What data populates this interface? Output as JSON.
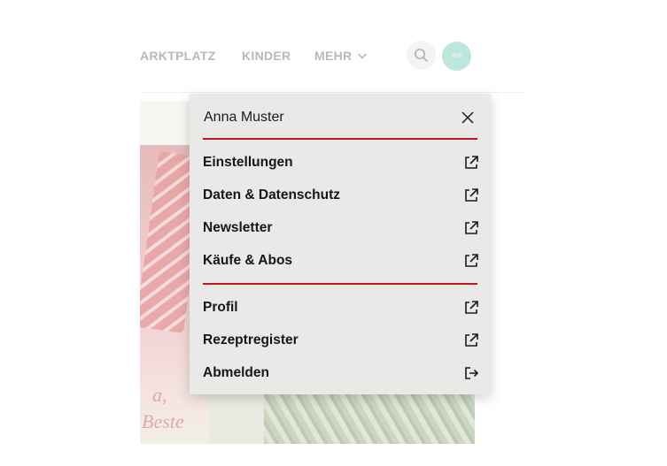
{
  "nav": {
    "items": [
      {
        "label": "MARKTPLATZ"
      },
      {
        "label": "KINDER"
      },
      {
        "label": "MEHR"
      }
    ]
  },
  "avatar": {
    "initials": "AM"
  },
  "hero": {
    "text_line1": "a,",
    "text_line2": "Beste"
  },
  "menu": {
    "user_name": "Anna Muster",
    "items": [
      {
        "label": "Einstellungen",
        "icon": "external-link-icon"
      },
      {
        "label": "Daten & Datenschutz",
        "icon": "external-link-icon"
      },
      {
        "label": "Newsletter",
        "icon": "external-link-icon"
      },
      {
        "label": "Käufe & Abos",
        "icon": "external-link-icon"
      },
      {
        "label": "Profil",
        "icon": "external-link-icon"
      },
      {
        "label": "Rezeptregister",
        "icon": "external-link-icon"
      },
      {
        "label": "Abmelden",
        "icon": "logout-icon"
      }
    ]
  },
  "colors": {
    "accent": "#c0171c",
    "menu_bg": "#e9eae7",
    "avatar_bg": "#bfe6dd"
  }
}
